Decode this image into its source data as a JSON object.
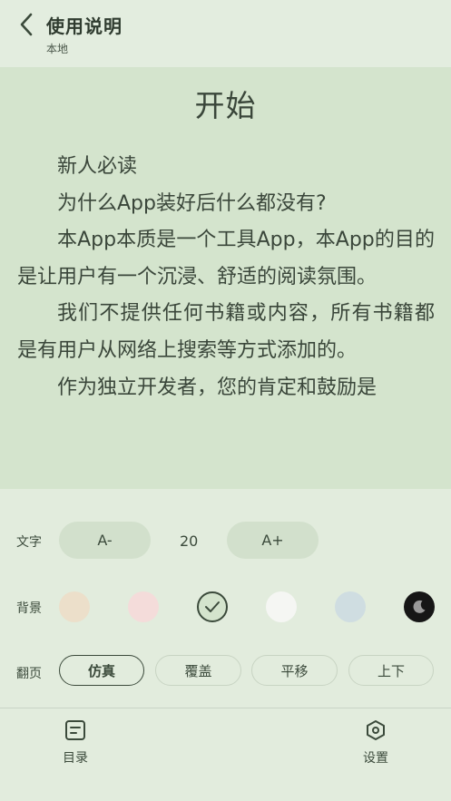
{
  "header": {
    "title": "使用说明",
    "subtitle": "本地",
    "back_icon": "chevron-left-icon"
  },
  "reader": {
    "chapter_title": "开始",
    "paragraphs": [
      "新人必读",
      "为什么App装好后什么都没有?",
      "本App本质是一个工具App，本App的目的是让用户有一个沉浸、舒适的阅读氛围。",
      "我们不提供任何书籍或内容，所有书籍都是有用户从网络上搜索等方式添加的。",
      "作为独立开发者，您的肯定和鼓励是"
    ]
  },
  "settings": {
    "text": {
      "label": "文字",
      "decrease": "A-",
      "size": "20",
      "increase": "A+"
    },
    "background": {
      "label": "背景",
      "swatches": [
        {
          "color": "#ecdfca"
        },
        {
          "color": "#f4dcda"
        },
        {
          "color": "#d4e4cd",
          "selected": true
        },
        {
          "color": "#f5f6f3"
        },
        {
          "color": "#cfdde1"
        },
        {
          "color": "#161616",
          "icon": "moon-icon"
        }
      ]
    },
    "page_turn": {
      "label": "翻页",
      "options": [
        "仿真",
        "覆盖",
        "平移",
        "上下"
      ],
      "selected": "仿真"
    }
  },
  "bottom_nav": {
    "toc": {
      "label": "目录",
      "icon": "list-icon"
    },
    "settings": {
      "label": "设置",
      "icon": "hexagon-settings-icon"
    }
  },
  "colors": {
    "accent": "#3b4a3b",
    "reader_bg": "#d4e4cd",
    "panel_bg": "#e2ecdd"
  }
}
